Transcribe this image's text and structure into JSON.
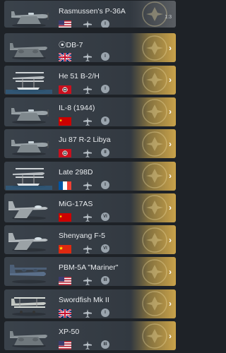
{
  "vehicles": [
    {
      "name": "Rasmussen's P-36A",
      "country": "usa",
      "rank": "I",
      "thumb": "fighter",
      "counter": "1:3"
    },
    {
      "name": "⦿DB-7",
      "country": "uk",
      "rank": "I",
      "thumb": "bomber"
    },
    {
      "name": "He 51 B-2/H",
      "country": "germany",
      "rank": "I",
      "thumb": "floatplane"
    },
    {
      "name": "IL-8 (1944)",
      "country": "ussr",
      "rank": "II",
      "thumb": "attacker"
    },
    {
      "name": "Ju 87 R-2 Libya",
      "country": "germany",
      "rank": "II",
      "thumb": "dive"
    },
    {
      "name": "Late 298D",
      "country": "france",
      "rank": "I",
      "thumb": "floatplane"
    },
    {
      "name": "MiG-17AS",
      "country": "ussr",
      "rank": "VI",
      "thumb": "jet"
    },
    {
      "name": "Shenyang F-5",
      "country": "china",
      "rank": "VI",
      "thumb": "jet"
    },
    {
      "name": "PBM-5A \"Mariner\"",
      "country": "usa",
      "rank": "III",
      "thumb": "flyingboat"
    },
    {
      "name": "Swordfish Mk II",
      "country": "uk",
      "rank": "I",
      "thumb": "biplane"
    },
    {
      "name": "XP-50",
      "country": "usa",
      "rank": "III",
      "thumb": "twin"
    }
  ],
  "colors": {
    "gold": "#c9a24a",
    "rowBg": "#3a424b",
    "pageBg": "#1e2227"
  },
  "icons": {
    "chevron": "chevron-right-icon",
    "emblem": "premium-emblem-icon",
    "rank": "rank-badge-icon",
    "plane": "aircraft-class-icon"
  }
}
